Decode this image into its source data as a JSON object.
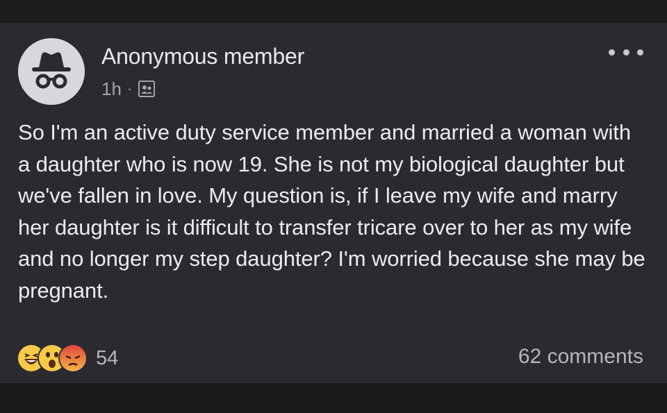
{
  "post": {
    "author": "Anonymous member",
    "time": "1h",
    "separator": "·",
    "audience_icon": "group-members-icon",
    "avatar_icon": "incognito-icon",
    "more_icon": "more-options-icon",
    "body": "So I'm an active duty service member and married a woman with a daughter who is now 19. She is not my biological daughter but we've fallen in love. My question is, if I leave my wife and marry her daughter is it difficult to transfer tricare over to her as my wife and no longer my step daughter? I'm worried because she may be pregnant."
  },
  "reactions": {
    "types": [
      "haha-emoji-icon",
      "wow-emoji-icon",
      "angry-emoji-icon"
    ],
    "count": "54"
  },
  "comments": {
    "label": "62 comments"
  },
  "colors": {
    "background": "#1a1a1d",
    "card": "#2a2a30",
    "primary_text": "#ececef",
    "secondary_text": "#b6b6bb"
  }
}
